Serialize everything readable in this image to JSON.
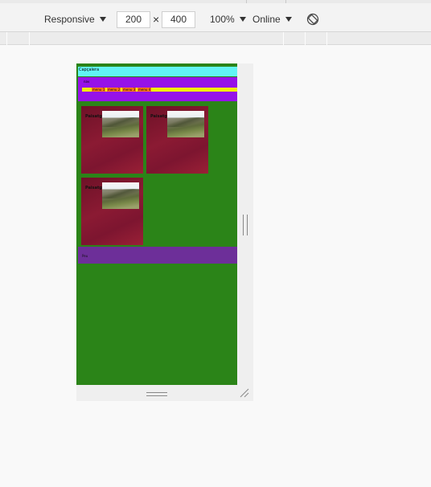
{
  "toolbar": {
    "device_label": "Responsive",
    "width_value": "200",
    "height_value": "400",
    "zoom_label": "100%",
    "network_label": "Online",
    "times_symbol": "×"
  },
  "page": {
    "header_text": "Capçalera",
    "nav_label": "nav",
    "menu_items": [
      "menu 1",
      "menu 2",
      "menu 3",
      "menu 4"
    ],
    "cards": [
      {
        "title": "Paisatge"
      },
      {
        "title": "Paisatge"
      },
      {
        "title": "Paisatge"
      }
    ],
    "footer_text": "Peu"
  },
  "colors": {
    "viewport_bg": "#2b8418",
    "header_bg": "#61f5f5",
    "nav_bg": "#9612e8",
    "menu_strip": "#f2f200",
    "menu_item": "#ff7a1a",
    "card_bg": "#8b1a33",
    "footer_bg": "#6d2f99"
  }
}
